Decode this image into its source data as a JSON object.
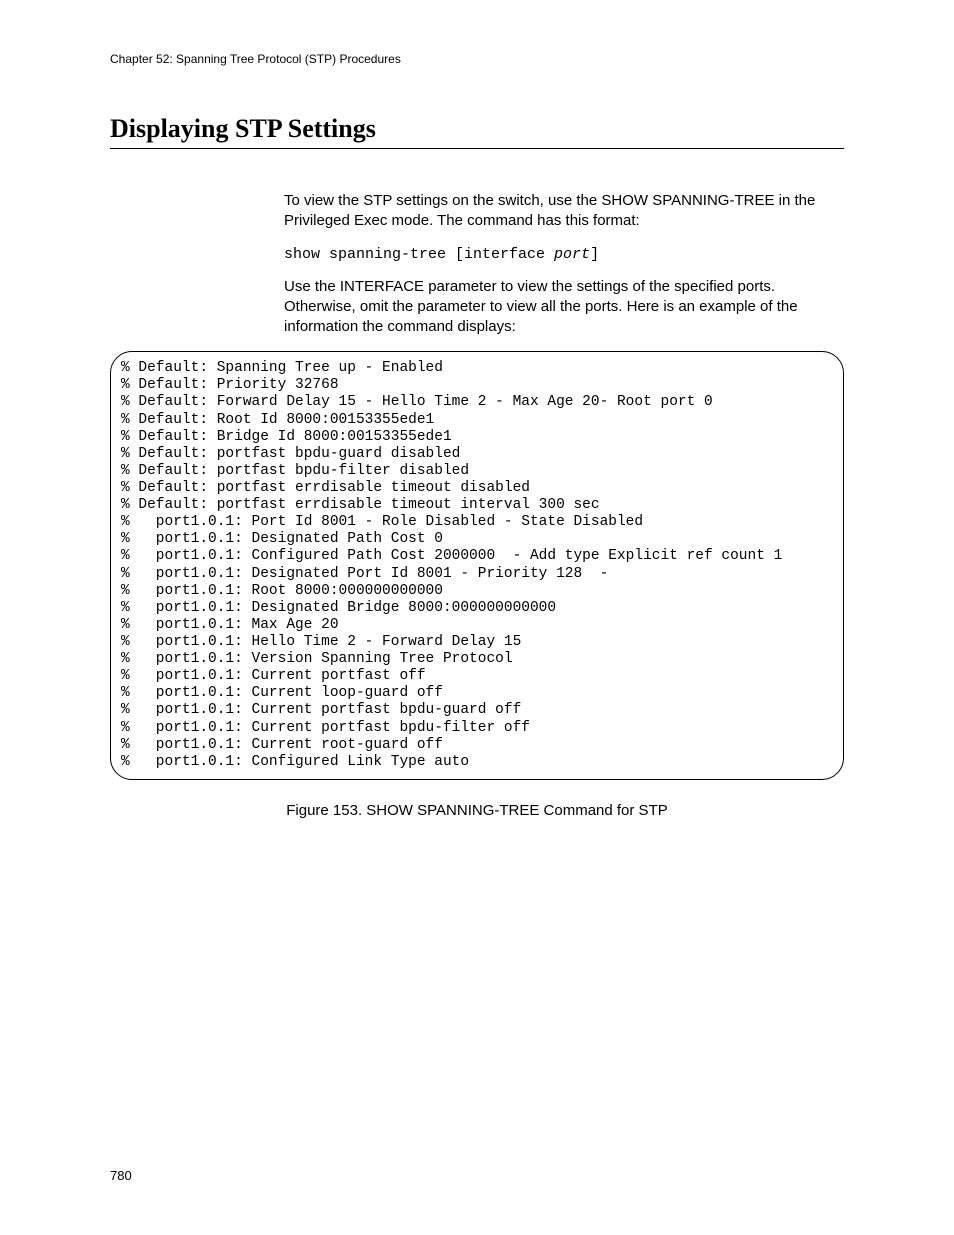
{
  "header": {
    "running_head": "Chapter 52: Spanning Tree Protocol (STP) Procedures"
  },
  "section": {
    "title": "Displaying STP Settings",
    "para1": "To view the STP settings on the switch, use the SHOW SPANNING-TREE in the Privileged Exec mode. The command has this format:",
    "syntax_plain": "show spanning-tree [interface ",
    "syntax_italic": "port",
    "syntax_tail": "]",
    "para2": "Use the INTERFACE parameter to view the settings of the specified ports. Otherwise, omit the parameter to view all the ports. Here is an example of the information the command displays:"
  },
  "output_lines": [
    "% Default: Spanning Tree up - Enabled",
    "% Default: Priority 32768",
    "% Default: Forward Delay 15 - Hello Time 2 - Max Age 20- Root port 0",
    "% Default: Root Id 8000:00153355ede1",
    "% Default: Bridge Id 8000:00153355ede1",
    "% Default: portfast bpdu-guard disabled",
    "% Default: portfast bpdu-filter disabled",
    "% Default: portfast errdisable timeout disabled",
    "% Default: portfast errdisable timeout interval 300 sec",
    "%   port1.0.1: Port Id 8001 - Role Disabled - State Disabled",
    "%   port1.0.1: Designated Path Cost 0",
    "%   port1.0.1: Configured Path Cost 2000000  - Add type Explicit ref count 1",
    "%   port1.0.1: Designated Port Id 8001 - Priority 128  -",
    "%   port1.0.1: Root 8000:000000000000",
    "%   port1.0.1: Designated Bridge 8000:000000000000",
    "%   port1.0.1: Max Age 20",
    "%   port1.0.1: Hello Time 2 - Forward Delay 15",
    "%   port1.0.1: Version Spanning Tree Protocol",
    "%   port1.0.1: Current portfast off",
    "%   port1.0.1: Current loop-guard off",
    "%   port1.0.1: Current portfast bpdu-guard off",
    "%   port1.0.1: Current portfast bpdu-filter off",
    "%   port1.0.1: Current root-guard off",
    "%   port1.0.1: Configured Link Type auto"
  ],
  "figure_caption": "Figure 153. SHOW SPANNING-TREE Command for STP",
  "page_number": "780"
}
